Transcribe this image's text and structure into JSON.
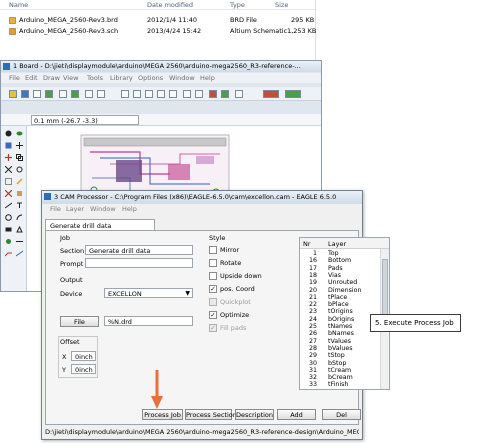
{
  "explorer": {
    "columns": [
      "Name",
      "Date modified",
      "Type",
      "Size"
    ],
    "files": [
      {
        "name": "Arduino_MEGA_2560-Rev3.brd",
        "date": "2012/1/4 11:40",
        "type": "BRD File",
        "size": "295 KB"
      },
      {
        "name": "Arduino_MEGA_2560-Rev3.sch",
        "date": "2013/4/24 15:42",
        "type": "Altium Schematic ...",
        "size": "1,253 KB"
      }
    ]
  },
  "board_window": {
    "title": "1 Board - D:\\jieti\\displaymodule\\arduino\\MEGA 2560\\arduino-mega2560_R3-reference-...",
    "menu": [
      "File",
      "Edit",
      "Draw",
      "View",
      "Tools",
      "Library",
      "Options",
      "Window",
      "Help"
    ],
    "coordinate": "0.1 mm (-26.7 -3.3)"
  },
  "cam": {
    "title": "3 CAM Processor - C:\\Program Files (x86)\\EAGLE-6.5.0\\cam\\excellon.cam - EAGLE 6.5.0",
    "menu": [
      "File",
      "Layer",
      "Window",
      "Help"
    ],
    "tab": "Generate drill data",
    "job_label": "Job",
    "section_label": "Section",
    "section_value": "Generate drill data",
    "prompt_label": "Prompt",
    "prompt_value": "",
    "output_label": "Output",
    "device_label": "Device",
    "device_value": "EXCELLON",
    "file_button": "File",
    "file_value": "%N.drd",
    "offset_label": "Offset",
    "x_label": "X",
    "x_value": "0inch",
    "y_label": "Y",
    "y_value": "0inch",
    "style_label": "Style",
    "styles": [
      {
        "label": "Mirror",
        "checked": false,
        "disabled": false
      },
      {
        "label": "Rotate",
        "checked": false,
        "disabled": false
      },
      {
        "label": "Upside down",
        "checked": false,
        "disabled": false
      },
      {
        "label": "pos. Coord",
        "checked": true,
        "disabled": false
      },
      {
        "label": "Quickplot",
        "checked": false,
        "disabled": true
      },
      {
        "label": "Optimize",
        "checked": true,
        "disabled": false
      },
      {
        "label": "Fill pads",
        "checked": true,
        "disabled": true
      }
    ],
    "layer_columns": [
      "Nr",
      "Layer"
    ],
    "layers": [
      {
        "nr": "1",
        "name": "Top"
      },
      {
        "nr": "16",
        "name": "Bottom"
      },
      {
        "nr": "17",
        "name": "Pads"
      },
      {
        "nr": "18",
        "name": "Vias"
      },
      {
        "nr": "19",
        "name": "Unrouted"
      },
      {
        "nr": "20",
        "name": "Dimension"
      },
      {
        "nr": "21",
        "name": "tPlace"
      },
      {
        "nr": "22",
        "name": "bPlace"
      },
      {
        "nr": "23",
        "name": "tOrigins"
      },
      {
        "nr": "24",
        "name": "bOrigins"
      },
      {
        "nr": "25",
        "name": "tNames"
      },
      {
        "nr": "26",
        "name": "bNames"
      },
      {
        "nr": "27",
        "name": "tValues"
      },
      {
        "nr": "28",
        "name": "bValues"
      },
      {
        "nr": "29",
        "name": "tStop"
      },
      {
        "nr": "30",
        "name": "bStop"
      },
      {
        "nr": "31",
        "name": "tCream"
      },
      {
        "nr": "32",
        "name": "bCream"
      },
      {
        "nr": "33",
        "name": "tFinish"
      }
    ],
    "buttons": {
      "process_job": "Process Job",
      "process_section": "Process Section",
      "description": "Description",
      "add": "Add",
      "del": "Del"
    },
    "status": "D:\\jieti\\displaymodule\\arduino\\MEGA 2560\\arduino-mega2560_R3-reference-design\\Arduino_MEGA_2560-Re"
  },
  "annotation": {
    "callout": "5. Execute Process Job",
    "arrow_color": "#e8703a"
  }
}
